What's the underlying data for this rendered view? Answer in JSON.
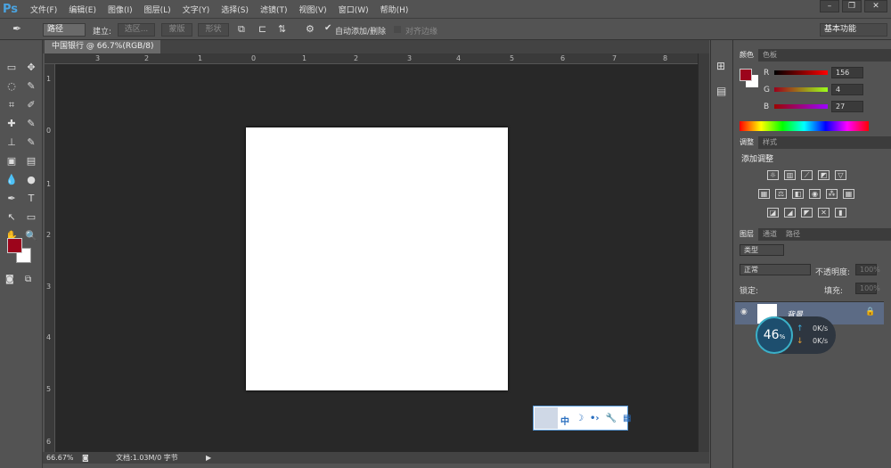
{
  "app": {
    "logo": "Ps",
    "menus": [
      "文件(F)",
      "编辑(E)",
      "图像(I)",
      "图层(L)",
      "文字(Y)",
      "选择(S)",
      "滤镜(T)",
      "视图(V)",
      "窗口(W)",
      "帮助(H)"
    ],
    "window_buttons": [
      "–",
      "❐",
      "✕"
    ]
  },
  "options": {
    "tool_mode": "路径",
    "make_label": "建立:",
    "buttons": [
      "选区...",
      "蒙版",
      "形状"
    ],
    "auto_add_delete": "自动添加/删除",
    "auto_add_checked": true,
    "align_edges": "对齐边缘",
    "align_checked": false,
    "workspace": "基本功能"
  },
  "tools": [
    "▭",
    "✥",
    "◌",
    "✎",
    "⌗",
    "✐",
    "✚",
    "✎",
    "⊥",
    "✎",
    "▣",
    "▤",
    "💧",
    "●",
    "✒",
    "T",
    "↖",
    "▭",
    "✋",
    "🔍"
  ],
  "colors": {
    "foreground": "#9c041b",
    "background": "#ffffff",
    "canvas": "#282828"
  },
  "document": {
    "tab_title": "中国银行 @ 66.7%(RGB/8)",
    "close": "×"
  },
  "rulers": {
    "horizontal": [
      "3",
      "2",
      "1",
      "0",
      "1",
      "2",
      "3",
      "4",
      "5",
      "6",
      "7",
      "8"
    ],
    "vertical": [
      "1",
      "0",
      "1",
      "2",
      "3",
      "4",
      "5",
      "6"
    ]
  },
  "status": {
    "zoom": "66.67%",
    "doc_info": "文档:1.03M/0 字节",
    "arrow": "▶"
  },
  "color_panel": {
    "tabs": [
      "颜色",
      "色板"
    ],
    "channels": [
      {
        "label": "R",
        "value": "156"
      },
      {
        "label": "G",
        "value": "4"
      },
      {
        "label": "B",
        "value": "27"
      }
    ]
  },
  "adjust_panel": {
    "tabs": [
      "调整",
      "样式"
    ],
    "title": "添加调整"
  },
  "layers_panel": {
    "tabs": [
      "图层",
      "通道",
      "路径"
    ],
    "filter": "类型",
    "blend_mode": "正常",
    "opacity_label": "不透明度:",
    "opacity_value": "100%",
    "lock_label": "锁定:",
    "fill_label": "填充:",
    "fill_value": "100%",
    "layers": [
      {
        "name": "背景",
        "visible": true,
        "locked": true
      }
    ]
  },
  "speed_widget": {
    "percent": "46",
    "percent_sign": "%",
    "upload": "0K/s",
    "download": "0K/s"
  },
  "ime_bar": {
    "items": [
      "中",
      "☽",
      "•›",
      "🔧",
      "▦"
    ]
  }
}
